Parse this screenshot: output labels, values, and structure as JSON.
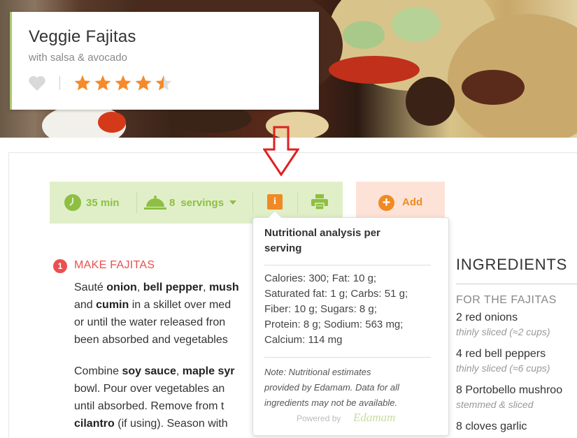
{
  "recipe": {
    "title": "Veggie Fajitas",
    "subtitle": "with salsa & avocado",
    "rating": 4.5,
    "rating_max": 5
  },
  "toolbar": {
    "time": "35 min",
    "servings_count": "8",
    "servings_label": "servings",
    "info_label": "i",
    "add_label": "Add"
  },
  "nutrition_popover": {
    "title": "Nutritional analysis per serving",
    "facts": [
      "Calories: 300; Fat: 10 g;",
      "Saturated fat: 1 g; Carbs: 51 g;",
      "Fiber: 10 g; Sugars: 8 g;",
      "Protein: 8 g; Sodium: 563 mg;",
      "Calcium: 114 mg"
    ],
    "note": [
      "Note: Nutritional estimates",
      "provided by Edamam. Data for all",
      "ingredients may not be available."
    ],
    "powered_by": "Powered by",
    "brand": "Edamam"
  },
  "steps": {
    "number": "1",
    "title": "MAKE FAJITAS",
    "p1": {
      "l1_a": "Sauté ",
      "l1_b": "onion",
      "l1_c": ", ",
      "l1_d": "bell pepper",
      "l1_e": ", ",
      "l1_f": "mush",
      "l2_a": "and ",
      "l2_b": "cumin",
      "l2_c": " in a skillet over med",
      "l3": "or until the water released fron",
      "l4": "been absorbed and vegetables"
    },
    "p2": {
      "l1_a": "Combine ",
      "l1_b": "soy sauce",
      "l1_c": ", ",
      "l1_d": "maple syr",
      "l2": "bowl. Pour over vegetables an",
      "l3": "until absorbed. Remove from t",
      "l4_a": "cilantro",
      "l4_b": " (if using). Season with"
    }
  },
  "ingredients": {
    "heading": "INGREDIENTS",
    "section": "FOR THE FAJITAS",
    "items": [
      {
        "name": "2 red onions",
        "note": "thinly sliced (≈2 cups)"
      },
      {
        "name": "4 red bell peppers",
        "note": "thinly sliced (≈6 cups)"
      },
      {
        "name": "8 Portobello mushroo",
        "note": "stemmed & sliced"
      },
      {
        "name": "8 cloves garlic",
        "note": ""
      }
    ]
  },
  "colors": {
    "accent_green": "#8dbf43",
    "accent_orange": "#f08a24",
    "step_red": "#ec4f4f",
    "annotation_red": "#e02020"
  }
}
